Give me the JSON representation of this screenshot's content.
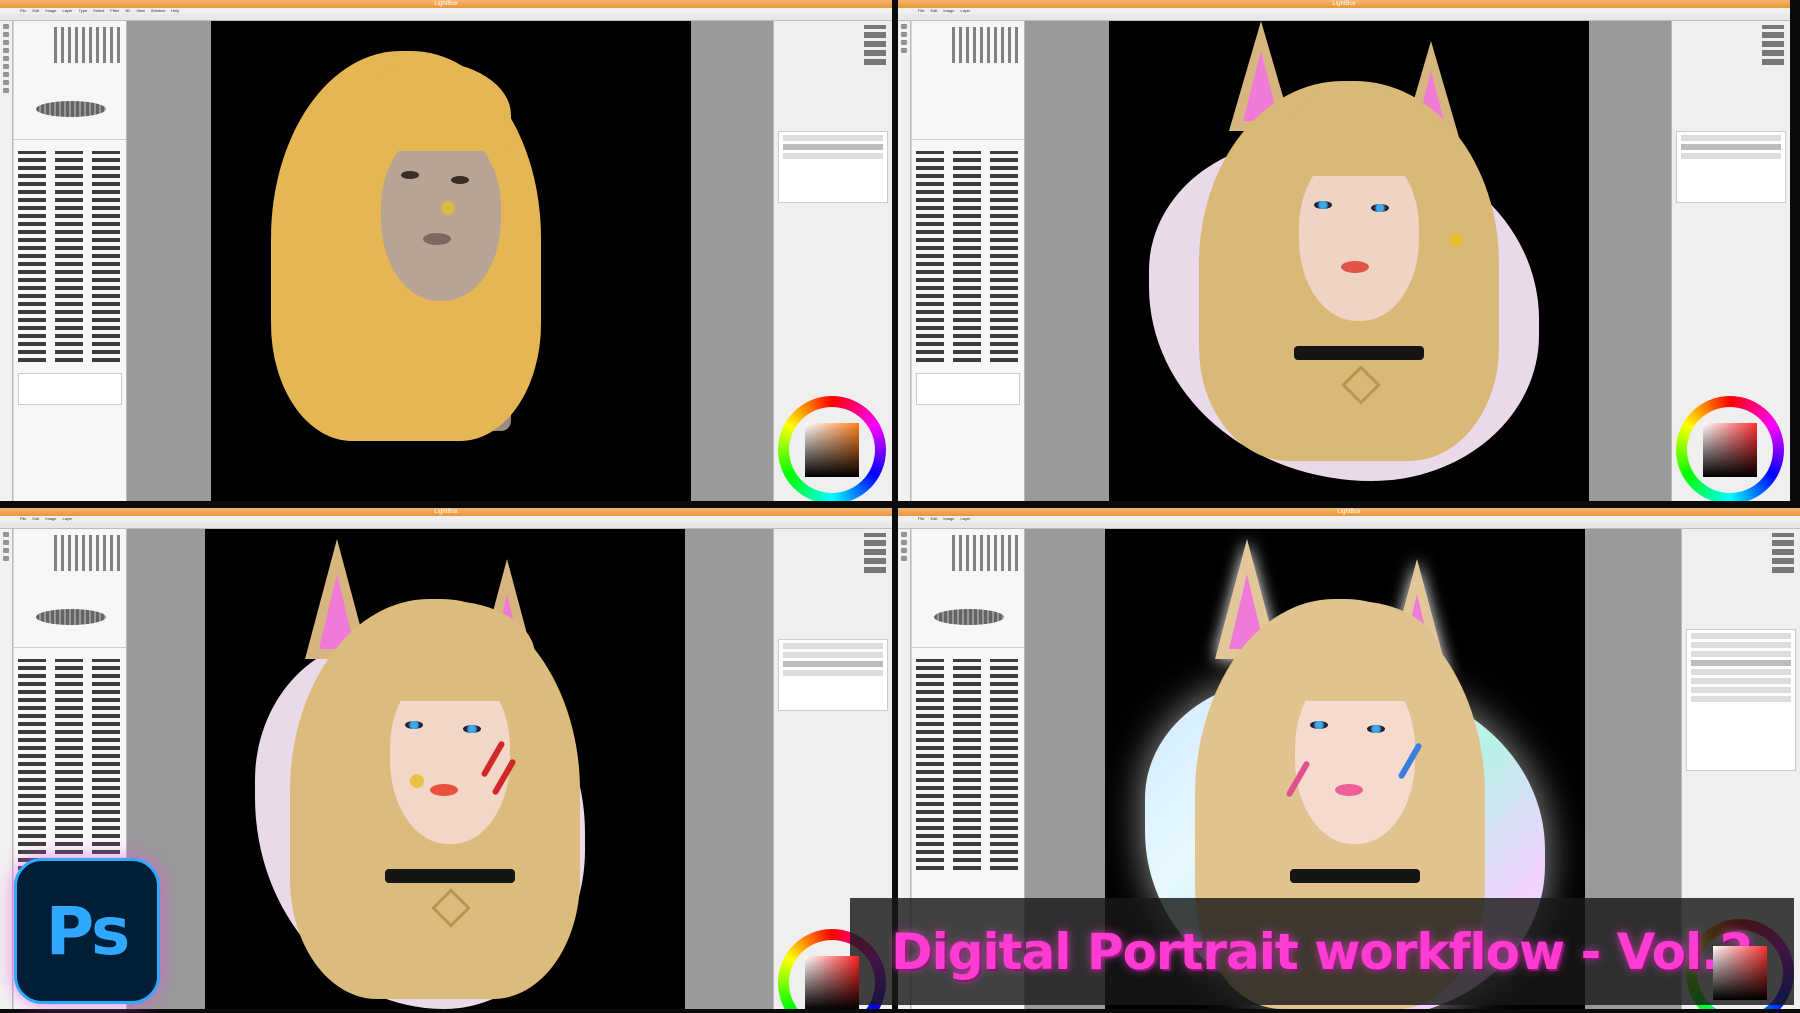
{
  "app": {
    "window_title": "LightBox",
    "menu_items": [
      "File",
      "Edit",
      "Image",
      "Layer",
      "Type",
      "Select",
      "Filter",
      "3D",
      "View",
      "Window",
      "Help"
    ]
  },
  "panels": [
    {
      "stage": 1,
      "artboard_bg": "#000000",
      "hair_color": "#e4b654",
      "skin_color": "#b7a497",
      "eye_style": "sketch",
      "has_ears": false,
      "background_shape": "none",
      "brush_color_hue": "#ff7f1e"
    },
    {
      "stage": 2,
      "artboard_bg": "#000000",
      "hair_color": "#d9b878",
      "skin_color": "#efd3c4",
      "eye_style": "blue",
      "has_ears": true,
      "background_shape": "pale-pink",
      "brush_color_hue": "#ff3030"
    },
    {
      "stage": 3,
      "artboard_bg": "#000000",
      "hair_color": "#dcbc7c",
      "skin_color": "#f2d6c8",
      "eye_style": "blue",
      "has_ears": true,
      "background_shape": "pale-pink",
      "face_paint": "#d02828",
      "brush_color_hue": "#ff2020"
    },
    {
      "stage": 4,
      "artboard_bg": "#000000",
      "hair_color": "#e1c38f",
      "skin_color": "#f4dbcd",
      "eye_style": "blue",
      "has_ears": true,
      "background_shape": "iridescent-glow",
      "face_paint": "#e05090",
      "brush_color_hue": "#ff3030"
    }
  ],
  "logo": {
    "text": "Ps",
    "icon": "photoshop-logo-icon"
  },
  "banner": {
    "title": "Digital Portrait workflow - Vol.2",
    "color": "#ff3bd2"
  }
}
